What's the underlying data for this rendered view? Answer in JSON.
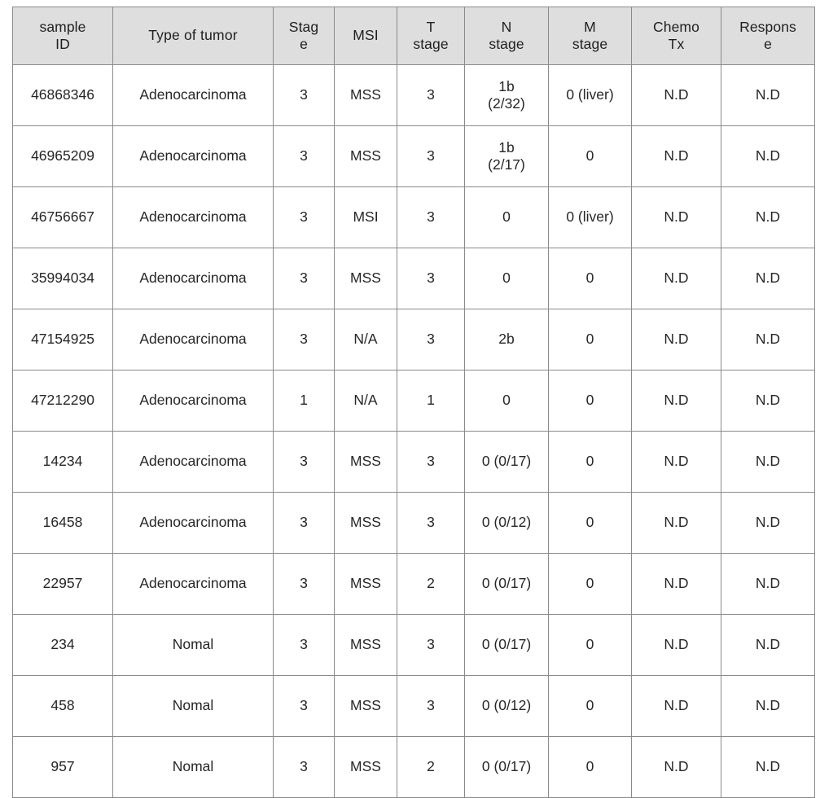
{
  "table": {
    "caption_present": false,
    "columns": [
      {
        "key": "sample_id",
        "label_line1": "sample",
        "label_line2": "ID"
      },
      {
        "key": "tumor_type",
        "label_line1": "Type  of  tumor",
        "label_line2": ""
      },
      {
        "key": "stage",
        "label_line1": "Stag",
        "label_line2": "e"
      },
      {
        "key": "msi",
        "label_line1": "MSI",
        "label_line2": ""
      },
      {
        "key": "t_stage",
        "label_line1": "T",
        "label_line2": "stage"
      },
      {
        "key": "n_stage",
        "label_line1": "N",
        "label_line2": "stage"
      },
      {
        "key": "m_stage",
        "label_line1": "M",
        "label_line2": "stage"
      },
      {
        "key": "chemo_tx",
        "label_line1": "Chemo",
        "label_line2": "Tx"
      },
      {
        "key": "response",
        "label_line1": "Respons",
        "label_line2": "e"
      }
    ],
    "rows": [
      {
        "sample_id": "46868346",
        "tumor_type": "Adenocarcinoma",
        "stage": "3",
        "msi": "MSS",
        "t_stage": "3",
        "n_stage_main": "1b",
        "n_stage_sub": "(2/32)",
        "m_stage": "0  (liver)",
        "chemo_tx": "N.D",
        "response": "N.D"
      },
      {
        "sample_id": "46965209",
        "tumor_type": "Adenocarcinoma",
        "stage": "3",
        "msi": "MSS",
        "t_stage": "3",
        "n_stage_main": "1b",
        "n_stage_sub": "(2/17)",
        "m_stage": "0",
        "chemo_tx": "N.D",
        "response": "N.D"
      },
      {
        "sample_id": "46756667",
        "tumor_type": "Adenocarcinoma",
        "stage": "3",
        "msi": "MSI",
        "t_stage": "3",
        "n_stage_main": "0",
        "n_stage_sub": "",
        "m_stage": "0  (liver)",
        "chemo_tx": "N.D",
        "response": "N.D"
      },
      {
        "sample_id": "35994034",
        "tumor_type": "Adenocarcinoma",
        "stage": "3",
        "msi": "MSS",
        "t_stage": "3",
        "n_stage_main": "0",
        "n_stage_sub": "",
        "m_stage": "0",
        "chemo_tx": "N.D",
        "response": "N.D"
      },
      {
        "sample_id": "47154925",
        "tumor_type": "Adenocarcinoma",
        "stage": "3",
        "msi": "N/A",
        "t_stage": "3",
        "n_stage_main": "2b",
        "n_stage_sub": "",
        "m_stage": "0",
        "chemo_tx": "N.D",
        "response": "N.D"
      },
      {
        "sample_id": "47212290",
        "tumor_type": "Adenocarcinoma",
        "stage": "1",
        "msi": "N/A",
        "t_stage": "1",
        "n_stage_main": "0",
        "n_stage_sub": "",
        "m_stage": "0",
        "chemo_tx": "N.D",
        "response": "N.D"
      },
      {
        "sample_id": "14234",
        "tumor_type": "Adenocarcinoma",
        "stage": "3",
        "msi": "MSS",
        "t_stage": "3",
        "n_stage_main": "0  (0/17)",
        "n_stage_sub": "",
        "m_stage": "0",
        "chemo_tx": "N.D",
        "response": "N.D"
      },
      {
        "sample_id": "16458",
        "tumor_type": "Adenocarcinoma",
        "stage": "3",
        "msi": "MSS",
        "t_stage": "3",
        "n_stage_main": "0  (0/12)",
        "n_stage_sub": "",
        "m_stage": "0",
        "chemo_tx": "N.D",
        "response": "N.D"
      },
      {
        "sample_id": "22957",
        "tumor_type": "Adenocarcinoma",
        "stage": "3",
        "msi": "MSS",
        "t_stage": "2",
        "n_stage_main": "0  (0/17)",
        "n_stage_sub": "",
        "m_stage": "0",
        "chemo_tx": "N.D",
        "response": "N.D"
      },
      {
        "sample_id": "234",
        "tumor_type": "Nomal",
        "stage": "3",
        "msi": "MSS",
        "t_stage": "3",
        "n_stage_main": "0  (0/17)",
        "n_stage_sub": "",
        "m_stage": "0",
        "chemo_tx": "N.D",
        "response": "N.D"
      },
      {
        "sample_id": "458",
        "tumor_type": "Nomal",
        "stage": "3",
        "msi": "MSS",
        "t_stage": "3",
        "n_stage_main": "0  (0/12)",
        "n_stage_sub": "",
        "m_stage": "0",
        "chemo_tx": "N.D",
        "response": "N.D"
      },
      {
        "sample_id": "957",
        "tumor_type": "Nomal",
        "stage": "3",
        "msi": "MSS",
        "t_stage": "2",
        "n_stage_main": "0  (0/17)",
        "n_stage_sub": "",
        "m_stage": "0",
        "chemo_tx": "N.D",
        "response": "N.D"
      }
    ]
  },
  "style": {
    "header_background": "#dedede",
    "body_background": "#ffffff",
    "border_color": "#8a8a8a",
    "text_color": "#262626"
  }
}
